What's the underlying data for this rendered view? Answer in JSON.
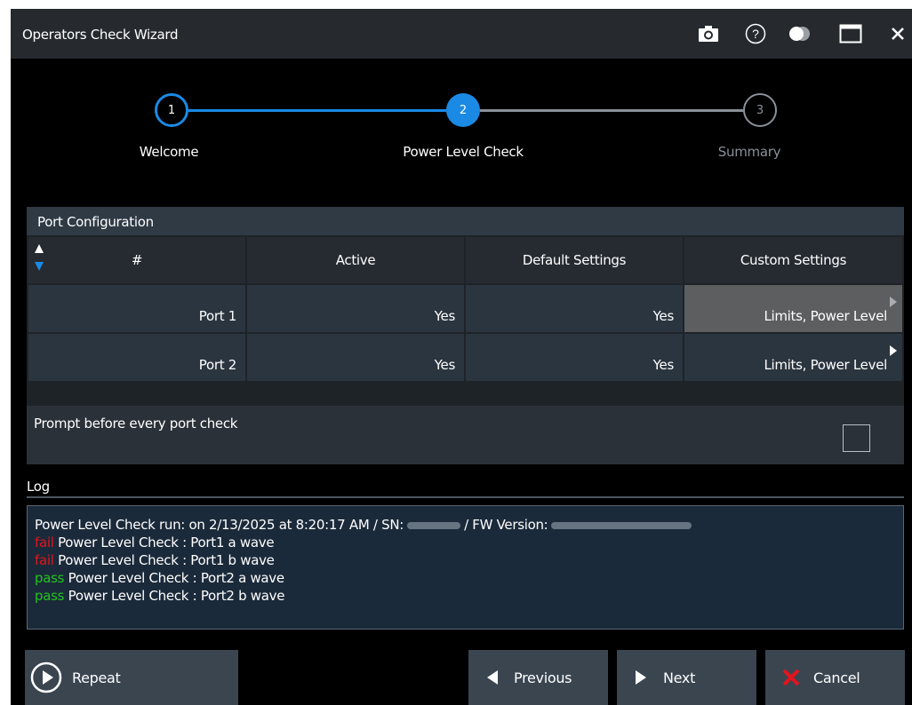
{
  "titlebar": {
    "title": "Operators Check Wizard",
    "icons": [
      "camera-icon",
      "help-icon",
      "toggle-icon",
      "maximize-icon",
      "close-icon"
    ]
  },
  "stepper": {
    "steps": [
      {
        "number": "1",
        "label": "Welcome",
        "state": "done"
      },
      {
        "number": "2",
        "label": "Power Level Check",
        "state": "active"
      },
      {
        "number": "3",
        "label": "Summary",
        "state": "pending"
      }
    ]
  },
  "port_config": {
    "title": "Port Configuration",
    "columns": [
      "#",
      "Active",
      "Default Settings",
      "Custom Settings"
    ],
    "rows": [
      {
        "port": "Port 1",
        "active": "Yes",
        "default": "Yes",
        "custom": "Limits, Power Level"
      },
      {
        "port": "Port 2",
        "active": "Yes",
        "default": "Yes",
        "custom": "Limits, Power Level"
      }
    ]
  },
  "prompt": {
    "label": "Prompt before every port check",
    "checked": false
  },
  "log": {
    "label": "Log",
    "header_prefix": "Power Level Check run: on 2/13/2025 at 8:20:17 AM / SN:",
    "header_mid": "/ FW Version:",
    "entries": [
      {
        "status": "fail",
        "text": "Power Level Check : Port1 a wave"
      },
      {
        "status": "fail",
        "text": "Power Level Check : Port1 b wave"
      },
      {
        "status": "pass",
        "text": "Power Level Check : Port2 a wave"
      },
      {
        "status": "pass",
        "text": "Power Level Check : Port2 b wave"
      }
    ]
  },
  "buttons": {
    "repeat": "Repeat",
    "previous": "Previous",
    "next": "Next",
    "cancel": "Cancel"
  },
  "colors": {
    "accent": "#1a8ae5",
    "fail": "#e0141e",
    "pass": "#21c41e",
    "cancel_icon": "#e4141c"
  }
}
